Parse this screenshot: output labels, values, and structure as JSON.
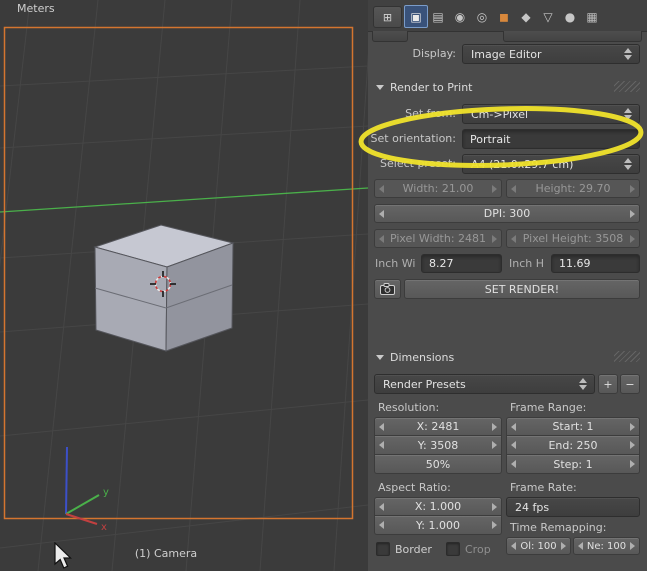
{
  "viewport": {
    "unit_label": "Meters",
    "camera_label": "(1) Camera",
    "axis_y_label": "y",
    "axis_x_label": "x"
  },
  "properties_header": {
    "editor_selector_glyph": "⊞",
    "tabs": [
      {
        "name": "render",
        "glyph": "▣",
        "active": true
      },
      {
        "name": "render-layers",
        "glyph": "▤",
        "active": false
      },
      {
        "name": "scene",
        "glyph": "◉",
        "active": false
      },
      {
        "name": "world",
        "glyph": "◎",
        "active": false
      },
      {
        "name": "object",
        "glyph": "◼",
        "active": false
      },
      {
        "name": "modifiers",
        "glyph": "◆",
        "active": false
      },
      {
        "name": "object-data",
        "glyph": "▽",
        "active": false
      },
      {
        "name": "material",
        "glyph": "●",
        "active": false
      },
      {
        "name": "texture",
        "glyph": "▦",
        "active": false
      }
    ]
  },
  "display_row": {
    "label": "Display:",
    "value": "Image Editor"
  },
  "render_to_print": {
    "title": "Render to Print",
    "set_from_label": "Set from:",
    "set_from_value": "Cm->Pixel",
    "set_orientation_label": "Set orientation:",
    "set_orientation_value": "Portrait",
    "select_preset_label": "Select preset:",
    "select_preset_value": "A4 (21.0x29.7 cm)",
    "width": "Width: 21.00",
    "height": "Height: 29.70",
    "dpi": "DPI: 300",
    "pixel_width": "Pixel Width: 2481",
    "pixel_height": "Pixel Height: 3508",
    "inch_width_label": "Inch Wi",
    "inch_width_value": "8.27",
    "inch_height_label": "Inch H",
    "inch_height_value": "11.69",
    "set_render_button": "SET RENDER!"
  },
  "dimensions": {
    "title": "Dimensions",
    "render_presets": "Render Presets",
    "add_preset": "+",
    "remove_preset": "−",
    "resolution_label": "Resolution:",
    "frame_range_label": "Frame Range:",
    "resolution_x": "X: 2481",
    "resolution_y": "Y: 3508",
    "resolution_percentage": "50%",
    "frame_start": "Start: 1",
    "frame_end": "End: 250",
    "frame_step": "Step: 1",
    "aspect_ratio_label": "Aspect Ratio:",
    "frame_rate_label": "Frame Rate:",
    "aspect_x": "X: 1.000",
    "aspect_y": "Y: 1.000",
    "fps": "24 fps",
    "time_remapping_label": "Time Remapping:",
    "border_checkbox": "Border",
    "crop_checkbox": "Crop",
    "old_remap": "Ol: 100",
    "new_remap": "Ne: 100"
  },
  "colors": {
    "camera_border": "#d4752f",
    "annotation_highlight": "#f0e32b",
    "axis_x": "#c24040",
    "axis_y": "#4ab04a",
    "axis_z": "#3c50c8"
  }
}
